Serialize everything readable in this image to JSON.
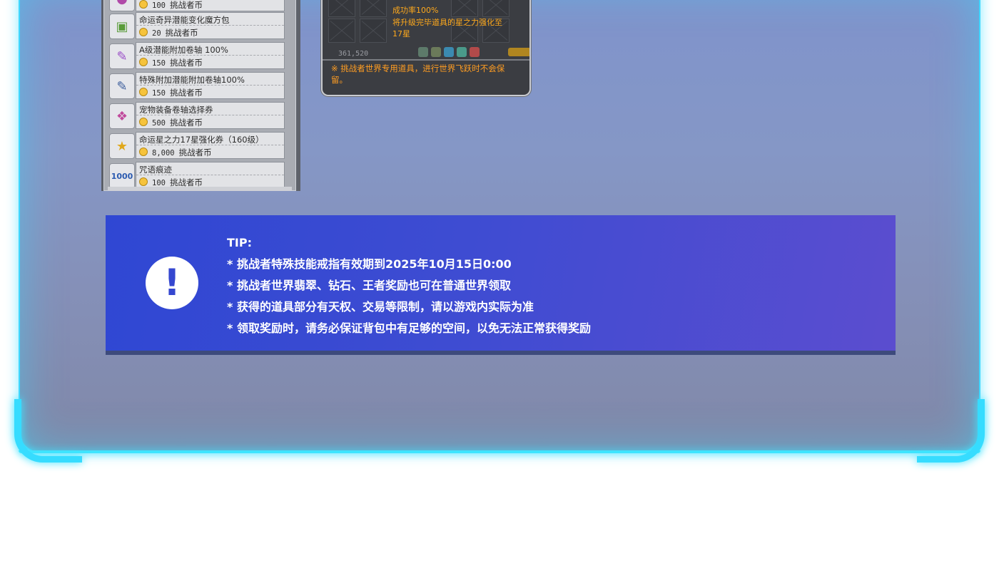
{
  "shop": {
    "items": [
      {
        "name": "",
        "price": "100",
        "currency": "挑战者币",
        "icon": "pink-bag-icon"
      },
      {
        "name": "命运奇异潜能变化魔方包",
        "price": "20",
        "currency": "挑战者币",
        "icon": "cube-package-icon"
      },
      {
        "name": "A级潜能附加卷轴 100%",
        "price": "150",
        "currency": "挑战者币",
        "icon": "purple-scroll-icon"
      },
      {
        "name": "特殊附加潜能附加卷轴100%",
        "price": "150",
        "currency": "挑战者币",
        "icon": "blue-scroll-icon"
      },
      {
        "name": "宠物装备卷轴选择券",
        "price": "500",
        "currency": "挑战者币",
        "icon": "pet-scroll-icon"
      },
      {
        "name": "命运星之力17星强化券（160级）",
        "price": "8,000",
        "currency": "挑战者币",
        "icon": "star-force-ticket-icon"
      },
      {
        "name": "咒语痕迹",
        "price": "100",
        "currency": "挑战者币",
        "icon": "spell-trace-icon"
      }
    ]
  },
  "tooltip": {
    "lines": [
      "成功率100%",
      "将升级完毕道具的星之力强化至",
      "17星"
    ],
    "meso": "361,520",
    "note": "※ 挑战者世界专用道具，进行世界飞跃时不会保留。"
  },
  "tip": {
    "heading": "TIP:",
    "items": [
      "* 挑战者特殊技能戒指有效期到2025年10月15日0:00",
      "* 挑战者世界翡翠、钻石、王者奖励也可在普通世界领取",
      "* 获得的道具部分有天权、交易等限制，请以游戏内实际为准",
      "* 领取奖励时，请务必保证背包中有足够的空间，以免无法正常获得奖励"
    ]
  },
  "colors": {
    "frame_glow": "#3fd8ff",
    "tip_bg": "#3e4cd2",
    "tooltip_text": "#ffa91c"
  }
}
